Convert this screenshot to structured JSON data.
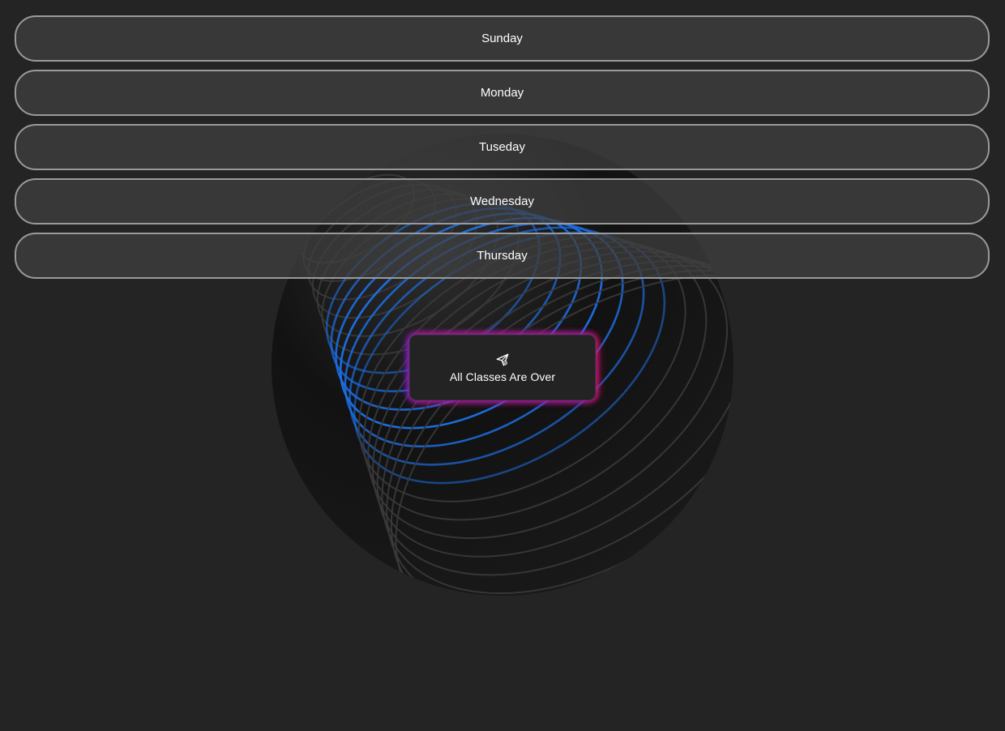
{
  "days": {
    "items": [
      {
        "label": "Sunday"
      },
      {
        "label": "Monday"
      },
      {
        "label": "Tuseday"
      },
      {
        "label": "Wednesday"
      },
      {
        "label": "Thursday"
      }
    ]
  },
  "status": {
    "icon": "paper-plane-icon",
    "text": "All Classes Are Over"
  },
  "colors": {
    "background": "#242424",
    "sphere_line_accent": "#1d6fe6",
    "sphere_line_dim": "#3a3a3a",
    "glow_left": "#6e28dc",
    "glow_right": "#e61450"
  }
}
